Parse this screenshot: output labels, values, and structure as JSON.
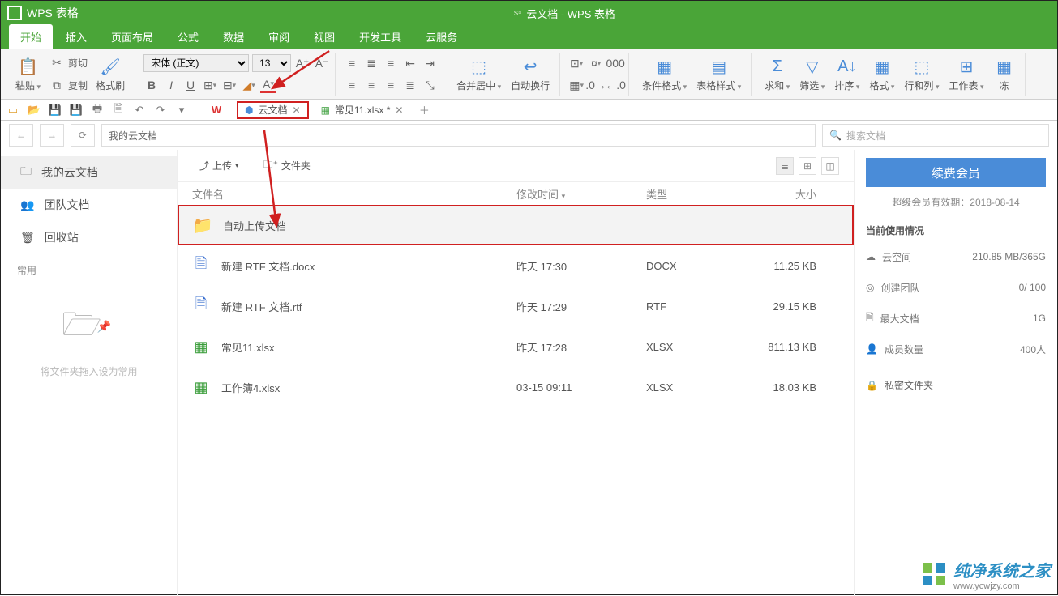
{
  "app_title": "WPS 表格",
  "window_title": "云文档 - WPS 表格",
  "menu": [
    "开始",
    "插入",
    "页面布局",
    "公式",
    "数据",
    "审阅",
    "视图",
    "开发工具",
    "云服务"
  ],
  "ribbon": {
    "paste": "粘贴",
    "cut": "剪切",
    "copy": "复制",
    "formatpaint": "格式刷",
    "font": "宋体 (正文)",
    "size": "13",
    "merge": "合并居中",
    "wrap": "自动换行",
    "condfmt": "条件格式",
    "tablestyle": "表格样式",
    "sum": "求和",
    "filter": "筛选",
    "sort": "排序",
    "format": "格式",
    "rowcol": "行和列",
    "worksheet": "工作表",
    "freeze": "冻"
  },
  "tabs": {
    "cloud": "云文档",
    "file2": "常见11.xlsx *"
  },
  "path": "我的云文档",
  "search_placeholder": "搜索文档",
  "sidebar": {
    "mydocs": "我的云文档",
    "team": "团队文档",
    "recycle": "回收站",
    "common": "常用",
    "droptip": "将文件夹拖入设为常用"
  },
  "toolbar": {
    "upload": "上传",
    "newfolder": "文件夹"
  },
  "columns": {
    "name": "文件名",
    "time": "修改时间",
    "type": "类型",
    "size": "大小"
  },
  "rows": [
    {
      "name": "自动上传文档",
      "time": "",
      "type": "",
      "size": "",
      "icon": "folder",
      "highlight": true
    },
    {
      "name": "新建 RTF 文档.docx",
      "time": "昨天 17:30",
      "type": "DOCX",
      "size": "11.25 KB",
      "icon": "docx"
    },
    {
      "name": "新建 RTF 文档.rtf",
      "time": "昨天 17:29",
      "type": "RTF",
      "size": "29.15 KB",
      "icon": "rtf"
    },
    {
      "name": "常见11.xlsx",
      "time": "昨天 17:28",
      "type": "XLSX",
      "size": "811.13 KB",
      "icon": "xlsx"
    },
    {
      "name": "工作簿4.xlsx",
      "time": "03-15 09:11",
      "type": "XLSX",
      "size": "18.03 KB",
      "icon": "xlsx"
    }
  ],
  "right": {
    "renew": "续费会员",
    "expire": "超级会员有效期：2018-08-14",
    "usage_title": "当前使用情况",
    "cloud_space": "云空间",
    "cloud_space_val": "210.85 MB/365G",
    "create_team": "创建团队",
    "create_team_val": "0/ 100",
    "max_doc": "最大文档",
    "max_doc_val": "1G",
    "members": "成员数量",
    "members_val": "400人",
    "private": "私密文件夹"
  },
  "watermark": {
    "text": "纯净系统之家",
    "url": "www.ycwjzy.com"
  }
}
